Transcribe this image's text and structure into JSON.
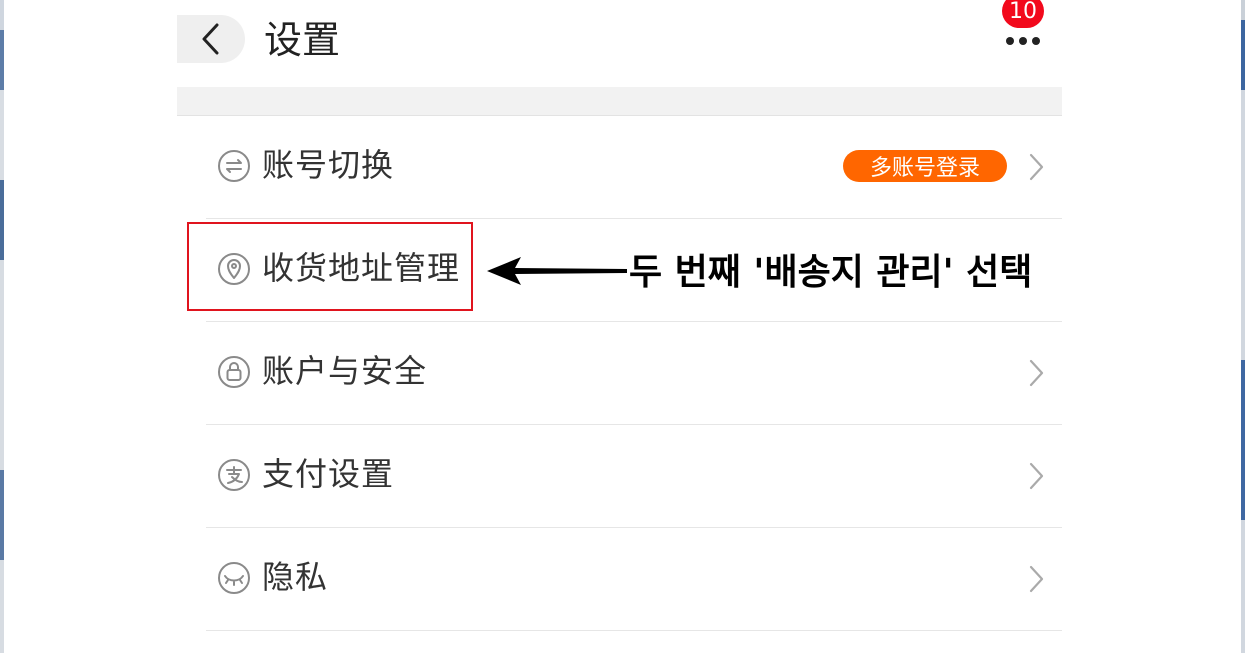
{
  "header": {
    "title": "设置",
    "notification_count": "10"
  },
  "rows": [
    {
      "label": "账号切换",
      "pill": "多账号登录",
      "icon": "swap-icon"
    },
    {
      "label": "收货地址管理",
      "icon": "location-pin-icon"
    },
    {
      "label": "账户与安全",
      "icon": "lock-icon"
    },
    {
      "label": "支付设置",
      "icon": "alipay-icon"
    },
    {
      "label": "隐私",
      "icon": "eye-closed-icon"
    }
  ],
  "annotation": {
    "text": "두 번째 '배송지 관리' 선택"
  },
  "colors": {
    "accent_orange": "#ff6600",
    "badge_red": "#f2091c",
    "highlight_red": "#e0141e"
  }
}
